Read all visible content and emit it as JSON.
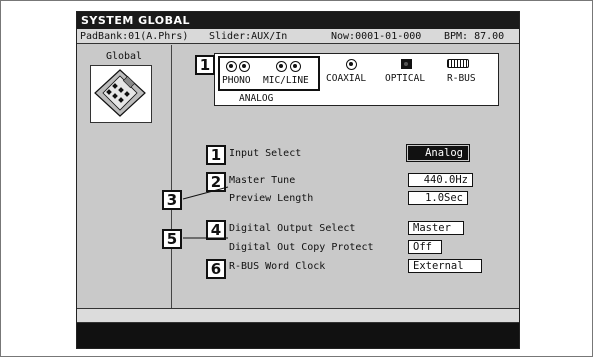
{
  "screen": {
    "title": "SYSTEM GLOBAL",
    "status": {
      "pad_bank": "PadBank:01(A.Phrs)",
      "slider": "Slider:AUX/In",
      "now": "Now:0001-01-000",
      "bpm": "BPM: 87.00"
    }
  },
  "sidebar": {
    "label": "Global",
    "icon": "sampler-device-icon"
  },
  "io_panel": {
    "phono_label": "PHONO",
    "mic_line_label": "MIC/LINE",
    "coaxial_label": "COAXIAL",
    "optical_label": "OPTICAL",
    "rbus_label": "R-BUS",
    "analog_label": "ANALOG"
  },
  "params": [
    {
      "label": "Input Select",
      "value": "Analog"
    },
    {
      "label": "Master Tune",
      "value": "440.0Hz"
    },
    {
      "label": "Preview Length",
      "value": "1.0Sec"
    },
    {
      "label": "Digital Output Select",
      "value": "Master"
    },
    {
      "label": "Digital Out Copy Protect",
      "value": "Off"
    },
    {
      "label": "R-BUS Word Clock",
      "value": "External"
    }
  ],
  "callouts": [
    "1",
    "1",
    "2",
    "3",
    "4",
    "5",
    "6"
  ],
  "colors": {
    "screen_bg": "#c9c9c9",
    "title_bg": "#1a1a1a",
    "highlight": "#111111"
  }
}
